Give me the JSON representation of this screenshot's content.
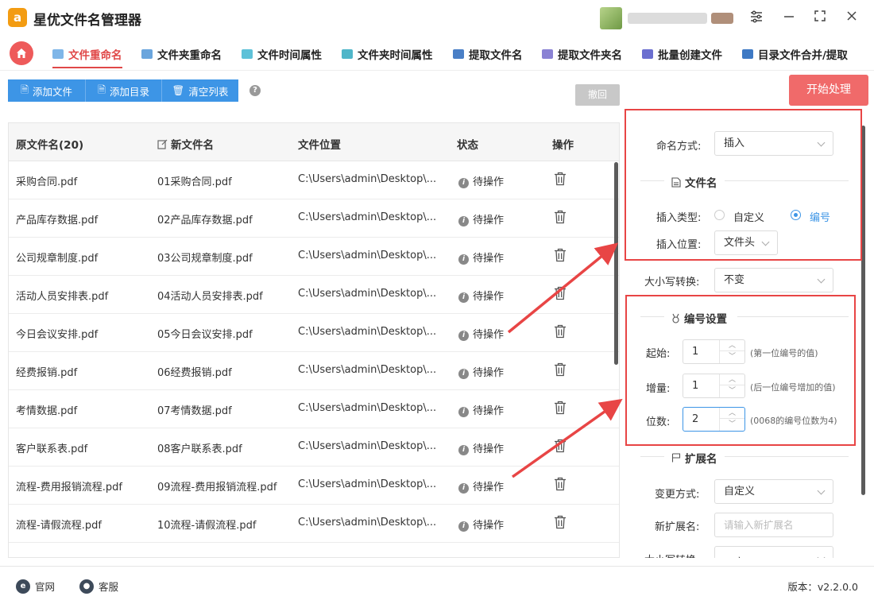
{
  "app": {
    "logo_letter": "a",
    "title": "星优文件名管理器"
  },
  "window": {
    "settings_glyph": "⚙",
    "minimize_glyph": "—",
    "maximize_glyph": "⛶",
    "close_glyph": "✕"
  },
  "tabs": [
    {
      "label": "文件重命名",
      "active": true
    },
    {
      "label": "文件夹重命名"
    },
    {
      "label": "文件时间属性"
    },
    {
      "label": "文件夹时间属性"
    },
    {
      "label": "提取文件名"
    },
    {
      "label": "提取文件夹名"
    },
    {
      "label": "批量创建文件"
    },
    {
      "label": "目录文件合并/提取"
    }
  ],
  "toolbar": {
    "add_file": "添加文件",
    "add_dir": "添加目录",
    "clear_list": "清空列表",
    "help_glyph": "?",
    "undo": "撤回",
    "start": "开始处理"
  },
  "table": {
    "headers": {
      "orig": "原文件名(20)",
      "new": "新文件名",
      "location": "文件位置",
      "status": "状态",
      "action": "操作"
    },
    "rows": [
      {
        "orig": "采购合同.pdf",
        "new": "01采购合同.pdf",
        "location": "C:\\Users\\admin\\Desktop\\...",
        "status": "待操作"
      },
      {
        "orig": "产品库存数据.pdf",
        "new": "02产品库存数据.pdf",
        "location": "C:\\Users\\admin\\Desktop\\...",
        "status": "待操作"
      },
      {
        "orig": "公司规章制度.pdf",
        "new": "03公司规章制度.pdf",
        "location": "C:\\Users\\admin\\Desktop\\...",
        "status": "待操作"
      },
      {
        "orig": "活动人员安排表.pdf",
        "new": "04活动人员安排表.pdf",
        "location": "C:\\Users\\admin\\Desktop\\...",
        "status": "待操作"
      },
      {
        "orig": "今日会议安排.pdf",
        "new": "05今日会议安排.pdf",
        "location": "C:\\Users\\admin\\Desktop\\...",
        "status": "待操作"
      },
      {
        "orig": "经费报销.pdf",
        "new": "06经费报销.pdf",
        "location": "C:\\Users\\admin\\Desktop\\...",
        "status": "待操作"
      },
      {
        "orig": "考情数据.pdf",
        "new": "07考情数据.pdf",
        "location": "C:\\Users\\admin\\Desktop\\...",
        "status": "待操作"
      },
      {
        "orig": "客户联系表.pdf",
        "new": "08客户联系表.pdf",
        "location": "C:\\Users\\admin\\Desktop\\...",
        "status": "待操作"
      },
      {
        "orig": "流程-费用报销流程.pdf",
        "new": "09流程-费用报销流程.pdf",
        "location": "C:\\Users\\admin\\Desktop\\...",
        "status": "待操作"
      },
      {
        "orig": "流程-请假流程.pdf",
        "new": "10流程-请假流程.pdf",
        "location": "C:\\Users\\admin\\Desktop\\...",
        "status": "待操作"
      }
    ]
  },
  "settings": {
    "naming_mode_label": "命名方式:",
    "naming_mode_value": "插入",
    "filename_section": "文件名",
    "insert_type_label": "插入类型:",
    "insert_type_custom": "自定义",
    "insert_type_number": "编号",
    "insert_pos_label": "插入位置:",
    "insert_pos_value": "文件头",
    "case_label": "大小写转换:",
    "case_value": "不变",
    "number_section": "编号设置",
    "start_label": "起始:",
    "start_value": "1",
    "start_hint": "(第一位编号的值)",
    "step_label": "增量:",
    "step_value": "1",
    "step_hint": "(后一位编号增加的值)",
    "digits_label": "位数:",
    "digits_value": "2",
    "digits_hint": "(0068的编号位数为4)",
    "ext_section": "扩展名",
    "ext_mode_label": "变更方式:",
    "ext_mode_value": "自定义",
    "new_ext_label": "新扩展名:",
    "new_ext_placeholder": "请输入新扩展名",
    "ext_case_label": "大小写转换:",
    "ext_case_value": "不变"
  },
  "footer": {
    "website": "官网",
    "support": "客服",
    "version": "版本：v2.2.0.0"
  }
}
